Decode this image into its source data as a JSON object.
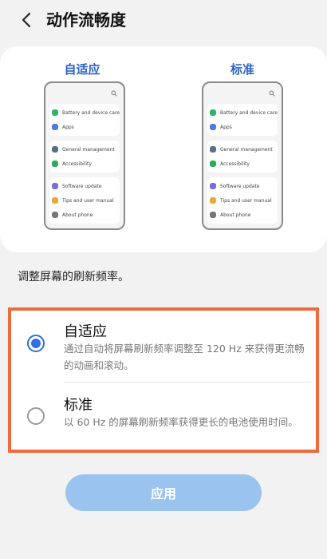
{
  "header": {
    "title": "动作流畅度"
  },
  "preview": {
    "left_label": "自适应",
    "right_label": "标准",
    "items": [
      {
        "label": "Battery and device care",
        "color": "#2fb36b"
      },
      {
        "label": "Apps",
        "color": "#4a7be0"
      },
      {
        "label": "General management",
        "color": "#5a6f86"
      },
      {
        "label": "Accessibility",
        "color": "#2faa5b"
      },
      {
        "label": "Software update",
        "color": "#7b6ae0"
      },
      {
        "label": "Tips and user manual",
        "color": "#f1a23a"
      },
      {
        "label": "About phone",
        "color": "#777777"
      }
    ]
  },
  "description": "调整屏幕的刷新频率。",
  "options": [
    {
      "title": "自适应",
      "subtitle": "通过自动将屏幕刷新频率调整至 120 Hz 来获得更流畅的动画和滚动。",
      "selected": true
    },
    {
      "title": "标准",
      "subtitle": "以 60 Hz 的屏幕刷新频率获得更长的电池使用时间。",
      "selected": false
    }
  ],
  "apply_label": "应用",
  "colors": {
    "accent": "#2f6fe0",
    "highlight_border": "#f06a3e",
    "button": "#9ac3ef",
    "label_blue": "#2b63c9"
  }
}
